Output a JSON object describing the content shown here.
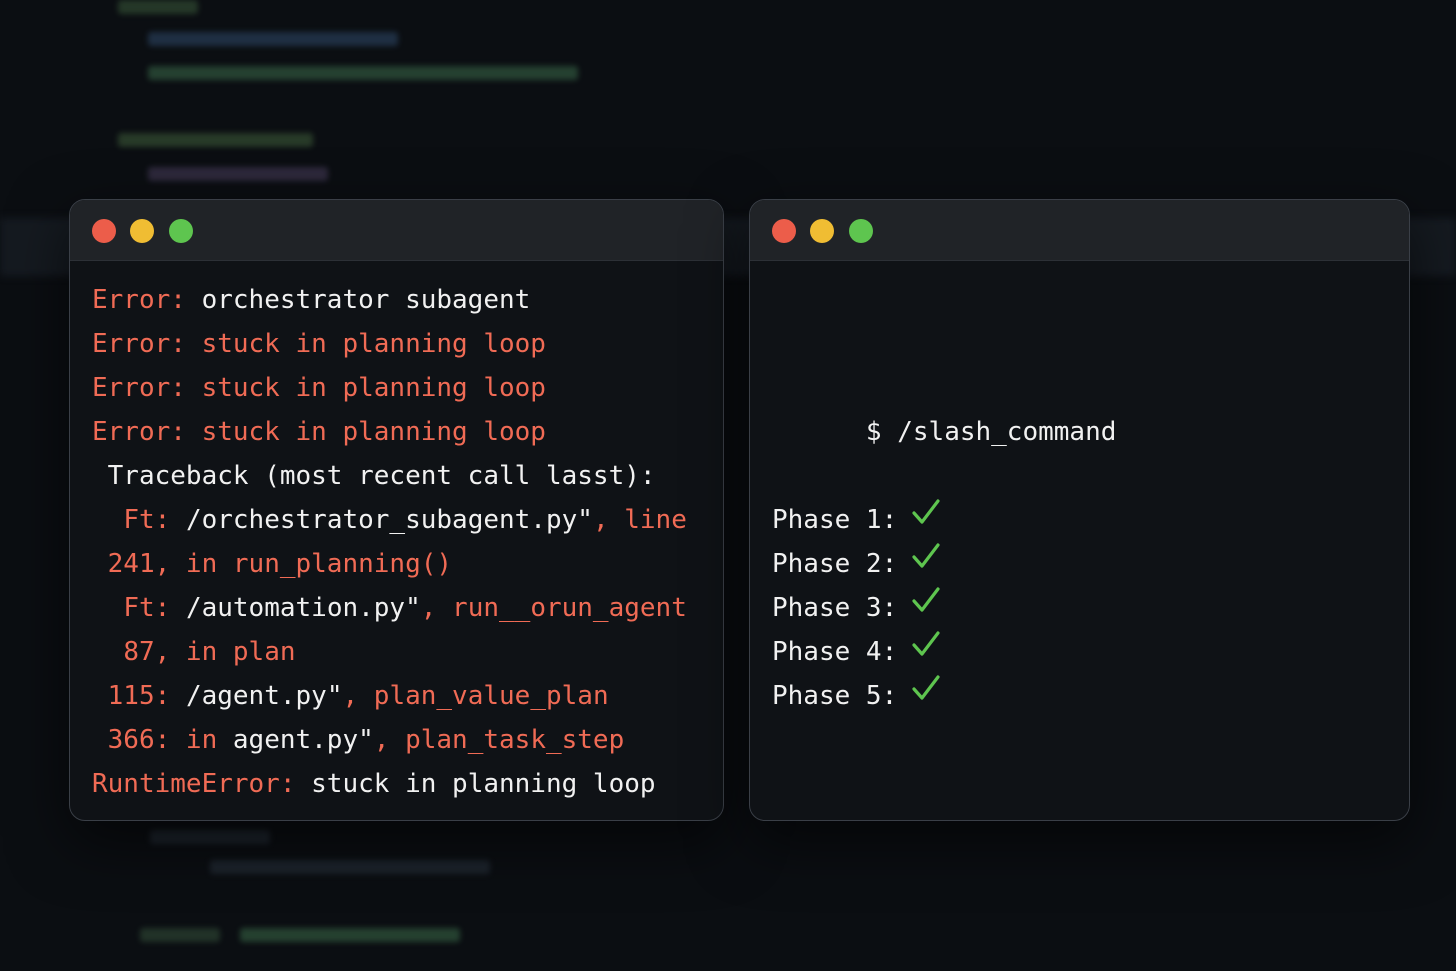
{
  "left_terminal": {
    "lines": [
      {
        "indent": "",
        "segments": [
          {
            "text": "Error: ",
            "color": "red"
          },
          {
            "text": "orchestrator subagent",
            "color": "white"
          }
        ]
      },
      {
        "indent": "",
        "segments": [
          {
            "text": "Error: stuck in planning loop",
            "color": "red"
          }
        ]
      },
      {
        "indent": "",
        "segments": [
          {
            "text": "Error: stuck in planning loop",
            "color": "red"
          }
        ]
      },
      {
        "indent": "",
        "segments": [
          {
            "text": "Error: stuck in planning loop",
            "color": "red"
          }
        ]
      },
      {
        "indent": " ",
        "segments": [
          {
            "text": "Traceback (most recent call lasst):",
            "color": "white"
          }
        ]
      },
      {
        "indent": "  ",
        "segments": [
          {
            "text": "Ft: ",
            "color": "red"
          },
          {
            "text": "/orchestrator_subagent.py\"",
            "color": "white"
          },
          {
            "text": ", line",
            "color": "red"
          }
        ]
      },
      {
        "indent": " ",
        "segments": [
          {
            "text": "241, in run_planning()",
            "color": "red"
          }
        ]
      },
      {
        "indent": "  ",
        "segments": [
          {
            "text": "Ft: ",
            "color": "red"
          },
          {
            "text": "/automation.py\"",
            "color": "white"
          },
          {
            "text": ", run__orun_agent",
            "color": "red"
          }
        ]
      },
      {
        "indent": "  ",
        "segments": [
          {
            "text": "87, in plan",
            "color": "red"
          }
        ]
      },
      {
        "indent": " ",
        "segments": [
          {
            "text": "115: ",
            "color": "red"
          },
          {
            "text": "/agent.py\"",
            "color": "white"
          },
          {
            "text": ", plan_value_plan",
            "color": "red"
          }
        ]
      },
      {
        "indent": " ",
        "segments": [
          {
            "text": "366: in ",
            "color": "red"
          },
          {
            "text": "agent.py\"",
            "color": "white"
          },
          {
            "text": ", plan_task_step",
            "color": "red"
          }
        ]
      },
      {
        "indent": "",
        "segments": [
          {
            "text": "RuntimeError: ",
            "color": "red"
          },
          {
            "text": "stuck in planning loop",
            "color": "white"
          }
        ]
      }
    ]
  },
  "right_terminal": {
    "prompt": "$ /slash_command",
    "phases": [
      {
        "label": "Phase 1:",
        "status_icon": "checkmark-icon"
      },
      {
        "label": "Phase 2:",
        "status_icon": "checkmark-icon"
      },
      {
        "label": "Phase 3:",
        "status_icon": "checkmark-icon"
      },
      {
        "label": "Phase 4:",
        "status_icon": "checkmark-icon"
      },
      {
        "label": "Phase 5:",
        "status_icon": "checkmark-icon"
      }
    ]
  },
  "colors": {
    "background": "#0b0e12",
    "terminal_bg": "#0f1216",
    "titlebar_bg": "#202327",
    "error_red": "#f06b55",
    "text_white": "#f1f1f1",
    "check_green": "#5ec54f",
    "dot_red": "#ec5d4a",
    "dot_yellow": "#f0bd33",
    "dot_green": "#5ec54f"
  }
}
